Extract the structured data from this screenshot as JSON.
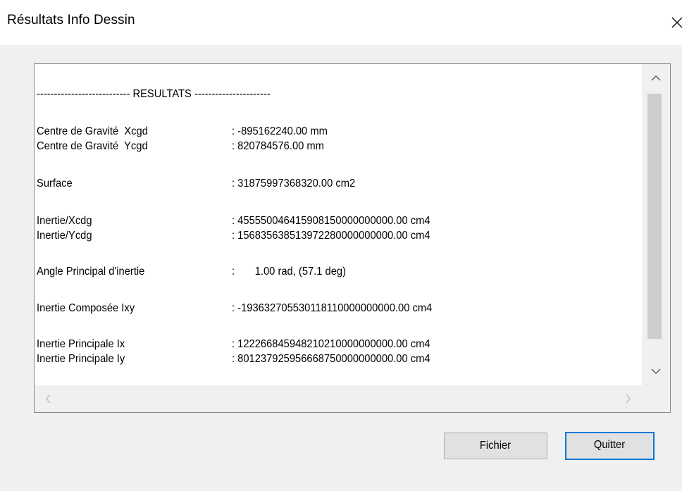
{
  "window": {
    "title": "Résultats Info Dessin"
  },
  "results": {
    "header": "--------------------------- RESULTATS ----------------------",
    "rows": [
      {
        "label": "Centre de Gravité  Xcgd",
        "value": ": -895162240.00 mm"
      },
      {
        "label": "Centre de Gravité  Ycgd",
        "value": ": 820784576.00 mm"
      },
      {
        "label": "Surface",
        "value": ": 31875997368320.00 cm2"
      },
      {
        "label": "Inertie/Xcdg",
        "value": ": 455550046415908150000000000.00 cm4"
      },
      {
        "label": "Inertie/Ycdg",
        "value": ": 156835638513972280000000000.00 cm4"
      },
      {
        "label": "Angle Principal d'inertie",
        "value": ":       1.00 rad, (57.1 deg)"
      },
      {
        "label": "Inertie Composée Ixy",
        "value": ": -193632705530118110000000000.00 cm4"
      },
      {
        "label": "Inertie Principale Ix",
        "value": ": 122266845948210210000000000.00 cm4"
      },
      {
        "label": "Inertie Principale Iy",
        "value": ": 801237925956668750000000000.00 cm4"
      }
    ]
  },
  "buttons": {
    "fichier": "Fichier",
    "quitter": "Quitter"
  }
}
